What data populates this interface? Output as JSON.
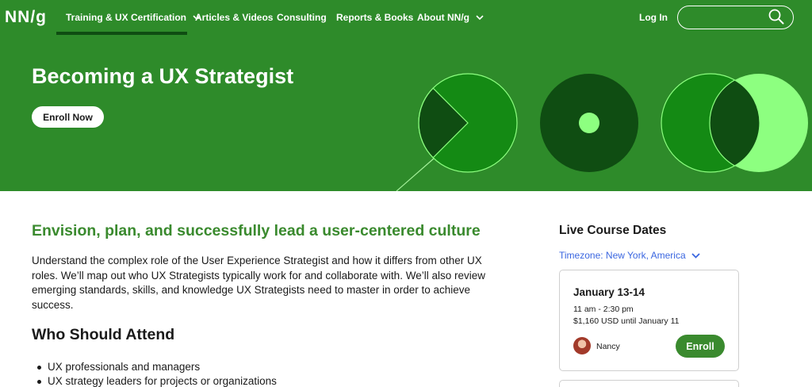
{
  "nav": {
    "logo": "NN/g",
    "items": [
      {
        "label": "Training & UX Certification",
        "dropdown": true
      },
      {
        "label": "Articles & Videos",
        "dropdown": false
      },
      {
        "label": "Consulting",
        "dropdown": false
      },
      {
        "label": "Reports & Books",
        "dropdown": false
      },
      {
        "label": "About NN/g",
        "dropdown": true
      }
    ],
    "login": "Log In",
    "search_value": "",
    "icons": {
      "search": "search-icon",
      "dropdown": "chevron-down-icon"
    }
  },
  "hero": {
    "title": "Becoming a UX Strategist",
    "cta": "Enroll Now"
  },
  "main": {
    "subtitle": "Envision, plan, and successfully lead a user-centered culture",
    "intro": "Understand the complex role of the User Experience Strategist and how it differs from other UX roles. We’ll map out who UX Strategists typically work for and collaborate with. We’ll also review emerging standards, skills, and knowledge UX Strategists need to master in order to achieve success.",
    "attend_heading": "Who Should Attend",
    "attend_items": [
      "UX professionals and managers",
      "UX strategy leaders for projects or organizations"
    ]
  },
  "sidebar": {
    "title": "Live Course Dates",
    "timezone": "Timezone: New York, America",
    "course": {
      "date": "January 13-14",
      "time": "11 am - 2:30 pm",
      "price": "$1,160 USD until January 11",
      "instructor": "Nancy",
      "enroll": "Enroll"
    }
  },
  "colors": {
    "brand_green": "#2e8b2a",
    "dark_green": "#0f4d12",
    "light_green": "#8dff80",
    "link_blue": "#3a66e0"
  }
}
